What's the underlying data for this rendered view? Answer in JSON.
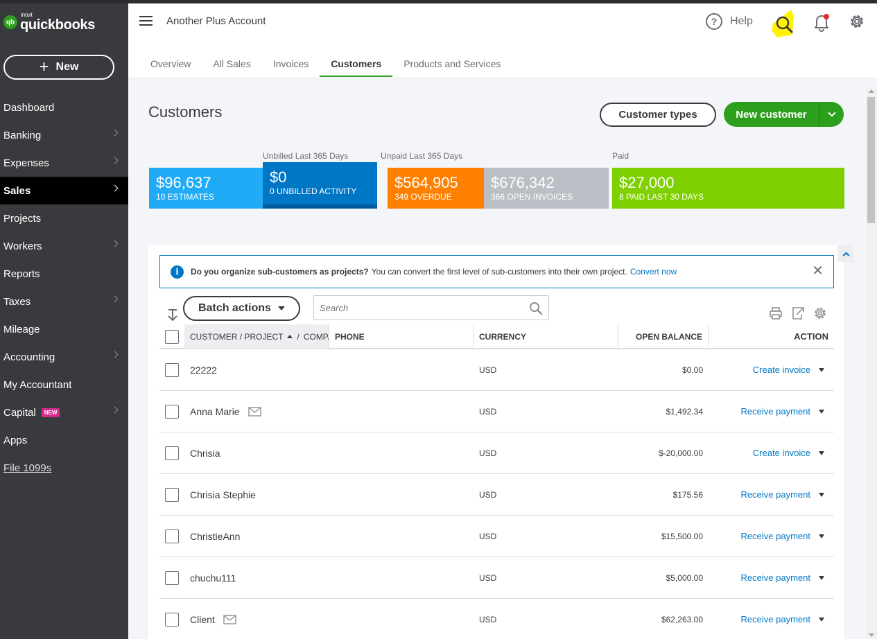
{
  "brand": {
    "intuit": "intuit",
    "name": "quickbooks",
    "mark": "qb"
  },
  "sidebar": {
    "new_label": "New",
    "items": [
      {
        "label": "Dashboard",
        "chevron": false
      },
      {
        "label": "Banking",
        "chevron": true
      },
      {
        "label": "Expenses",
        "chevron": true
      },
      {
        "label": "Sales",
        "chevron": true,
        "active": true
      },
      {
        "label": "Projects",
        "chevron": false
      },
      {
        "label": "Workers",
        "chevron": true
      },
      {
        "label": "Reports",
        "chevron": false
      },
      {
        "label": "Taxes",
        "chevron": true
      },
      {
        "label": "Mileage",
        "chevron": false
      },
      {
        "label": "Accounting",
        "chevron": true
      },
      {
        "label": "My Accountant",
        "chevron": false
      },
      {
        "label": "Capital",
        "chevron": true,
        "badge": "NEW"
      },
      {
        "label": "Apps",
        "chevron": false
      },
      {
        "label": "File 1099s",
        "chevron": false,
        "link": true
      }
    ]
  },
  "header": {
    "company": "Another Plus Account",
    "help_label": "Help",
    "help_glyph": "?",
    "icons": [
      "hamburger-icon",
      "help-icon",
      "search-icon",
      "bell-icon",
      "gear-icon"
    ],
    "tabs": [
      {
        "label": "Overview"
      },
      {
        "label": "All Sales"
      },
      {
        "label": "Invoices"
      },
      {
        "label": "Customers",
        "active": true
      },
      {
        "label": "Products and Services"
      }
    ]
  },
  "page": {
    "title": "Customers",
    "customer_types_label": "Customer types",
    "new_customer_label": "New customer"
  },
  "stats": {
    "labels": {
      "unbilled": "Unbilled Last 365 Days",
      "unpaid": "Unpaid Last 365 Days",
      "paid": "Paid"
    },
    "tiles": [
      {
        "amount": "$96,637",
        "sub": "10 ESTIMATES",
        "color": "#21abf6"
      },
      {
        "amount": "$0",
        "sub": "0 UNBILLED ACTIVITY",
        "color": "#0077c5"
      },
      {
        "amount": "$564,905",
        "sub": "349 OVERDUE",
        "color": "#ff8000"
      },
      {
        "amount": "$676,342",
        "sub": "366 OPEN INVOICES",
        "color": "#babec5"
      },
      {
        "amount": "$27,000",
        "sub": "8 PAID LAST 30 DAYS",
        "color": "#7fd000"
      }
    ]
  },
  "banner": {
    "icon": "i",
    "question": "Do you organize sub-customers as projects?",
    "text": "You can convert the first level of sub-customers into their own project.",
    "link": "Convert now",
    "close": "✕"
  },
  "table": {
    "batch_label": "Batch actions",
    "search_placeholder": "Search",
    "headers": {
      "name": "CUSTOMER / PROJECT",
      "name_sep": "/",
      "company": "COMPA",
      "phone": "PHONE",
      "currency": "CURRENCY",
      "balance": "OPEN BALANCE",
      "action": "ACTION"
    },
    "rows": [
      {
        "name": "22222",
        "mail": false,
        "currency": "USD",
        "balance": "$0.00",
        "action": "Create invoice"
      },
      {
        "name": "Anna Marie",
        "mail": true,
        "currency": "USD",
        "balance": "$1,492.34",
        "action": "Receive payment"
      },
      {
        "name": "Chrisia",
        "mail": false,
        "currency": "USD",
        "balance": "$-20,000.00",
        "action": "Create invoice"
      },
      {
        "name": "Chrisia Stephie",
        "mail": false,
        "currency": "USD",
        "balance": "$175.56",
        "action": "Receive payment"
      },
      {
        "name": "ChristieAnn",
        "mail": false,
        "currency": "USD",
        "balance": "$15,500.00",
        "action": "Receive payment"
      },
      {
        "name": "chuchu111",
        "mail": false,
        "currency": "USD",
        "balance": "$5,000.00",
        "action": "Receive payment"
      },
      {
        "name": "Client",
        "mail": true,
        "currency": "USD",
        "balance": "$62,263.00",
        "action": "Receive payment"
      }
    ]
  },
  "colors": {
    "brand_green": "#2ca01c",
    "link_blue": "#0077c5",
    "sidebar_bg": "#393a3d",
    "search_highlight": "#fff200"
  }
}
